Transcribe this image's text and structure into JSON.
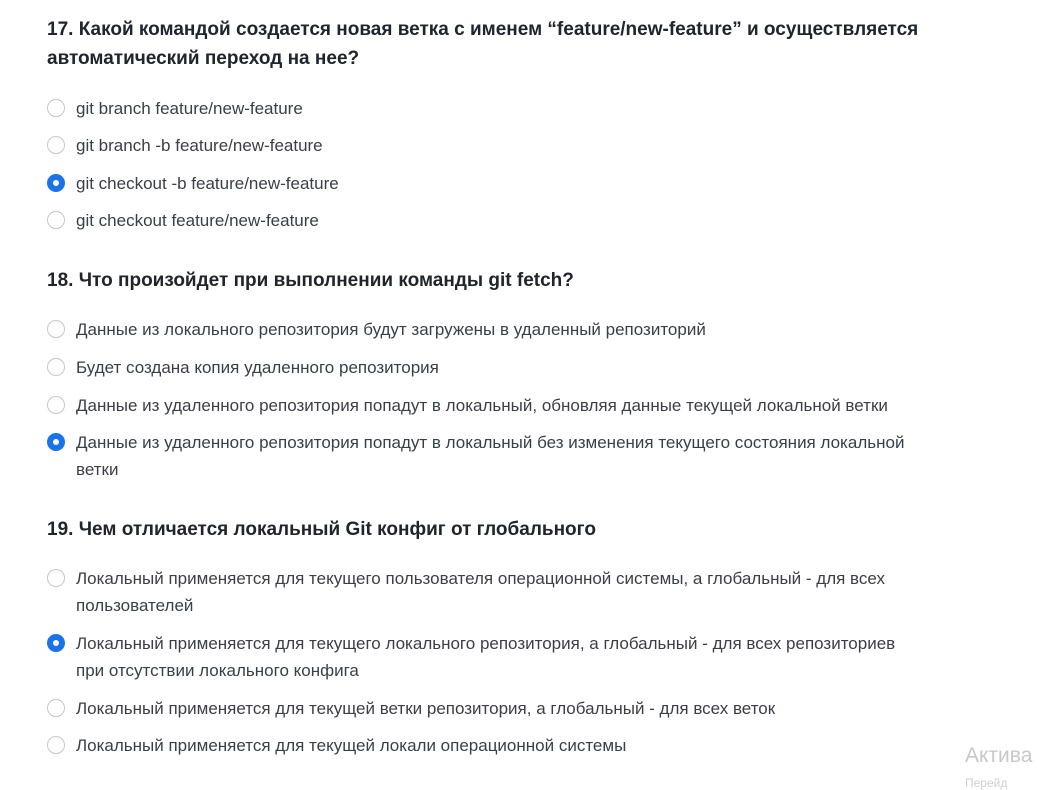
{
  "questions": [
    {
      "title": "17. Какой командой создается новая ветка с именем “feature/new-feature” и осуществляется автоматический переход на нее?",
      "options": [
        {
          "label": "git branch feature/new-feature",
          "selected": false
        },
        {
          "label": "git branch -b feature/new-feature",
          "selected": false
        },
        {
          "label": "git checkout -b feature/new-feature",
          "selected": true
        },
        {
          "label": "git checkout feature/new-feature",
          "selected": false
        }
      ]
    },
    {
      "title": "18. Что произойдет при выполнении команды git fetch?",
      "options": [
        {
          "label": "Данные из локального репозитория будут загружены в удаленный репозиторий",
          "selected": false
        },
        {
          "label": "Будет создана копия удаленного репозитория",
          "selected": false
        },
        {
          "label": "Данные из удаленного репозитория попадут в локальный, обновляя данные текущей локальной ветки",
          "selected": false
        },
        {
          "label": "Данные из удаленного репозитория попадут в локальный без изменения текущего состояния локальной ветки",
          "selected": true
        }
      ]
    },
    {
      "title": "19. Чем отличается локальный Git конфиг от глобального",
      "options": [
        {
          "label": "Локальный применяется для текущего пользователя операционной системы, а глобальный - для всех пользователей",
          "selected": false
        },
        {
          "label": "Локальный применяется для текущего локального репозитория, а глобальный - для всех репозиториев при отсутствии локального конфига",
          "selected": true
        },
        {
          "label": "Локальный применяется для текущей ветки репозитория, а глобальный - для всех веток",
          "selected": false
        },
        {
          "label": "Локальный применяется для текущей локали операционной системы",
          "selected": false
        }
      ]
    }
  ],
  "watermark": {
    "line1": "Актива",
    "line2": "Перейд"
  },
  "colors": {
    "accent": "#1a73e8",
    "radio_border": "#c4c8cc",
    "text": "#3a3f44",
    "heading": "#212529"
  }
}
